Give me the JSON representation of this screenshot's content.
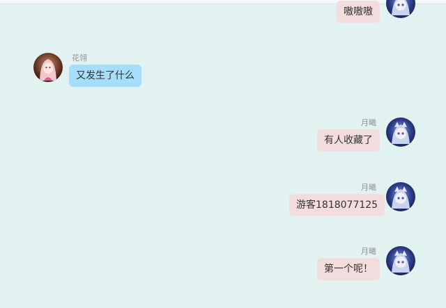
{
  "colors": {
    "background": "#e1f2f1",
    "self_bubble": "#f3dcdd",
    "other_bubble": "#a4defa",
    "name_text": "#8e8e8e"
  },
  "messages": [
    {
      "side": "right",
      "sender": "",
      "text": "嗷嗷嗷",
      "avatar": "yuexi-avatar"
    },
    {
      "side": "left",
      "sender": "花翎",
      "text": "又发生了什么",
      "avatar": "hualing-avatar"
    },
    {
      "side": "right",
      "sender": "月曦",
      "text": "有人收藏了",
      "avatar": "yuexi-avatar"
    },
    {
      "side": "right",
      "sender": "月曦",
      "text": "游客1818077125",
      "avatar": "yuexi-avatar"
    },
    {
      "side": "right",
      "sender": "月曦",
      "text": "第一个呢！",
      "avatar": "yuexi-avatar"
    }
  ]
}
